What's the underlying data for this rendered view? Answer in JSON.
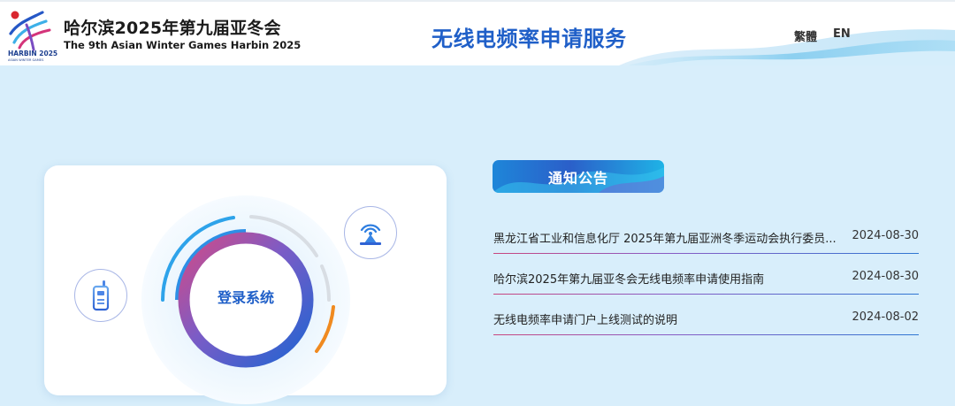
{
  "header": {
    "event_name_cn": "哈尔滨2025年第九届亚冬会",
    "event_name_en": "The 9th Asian Winter Games Harbin 2025",
    "logo_caption": "HARBIN 2025",
    "logo_subcaption": "ASIAN WINTER GAMES",
    "site_title": "无线电频率申请服务",
    "lang_traditional": "繁體",
    "lang_english": "EN"
  },
  "login": {
    "label": "登录系统"
  },
  "notices": {
    "title": "通知公告",
    "items": [
      {
        "text": "黑龙江省工业和信息化厅 2025年第九届亚洲冬季运动会执行委员...",
        "date": "2024-08-30"
      },
      {
        "text": "哈尔滨2025年第九届亚冬会无线电频率申请使用指南",
        "date": "2024-08-30"
      },
      {
        "text": "无线电频率申请门户上线测试的说明",
        "date": "2024-08-02"
      }
    ]
  },
  "colors": {
    "brand_blue": "#1f5fc8",
    "page_background": "#d8eefb"
  }
}
